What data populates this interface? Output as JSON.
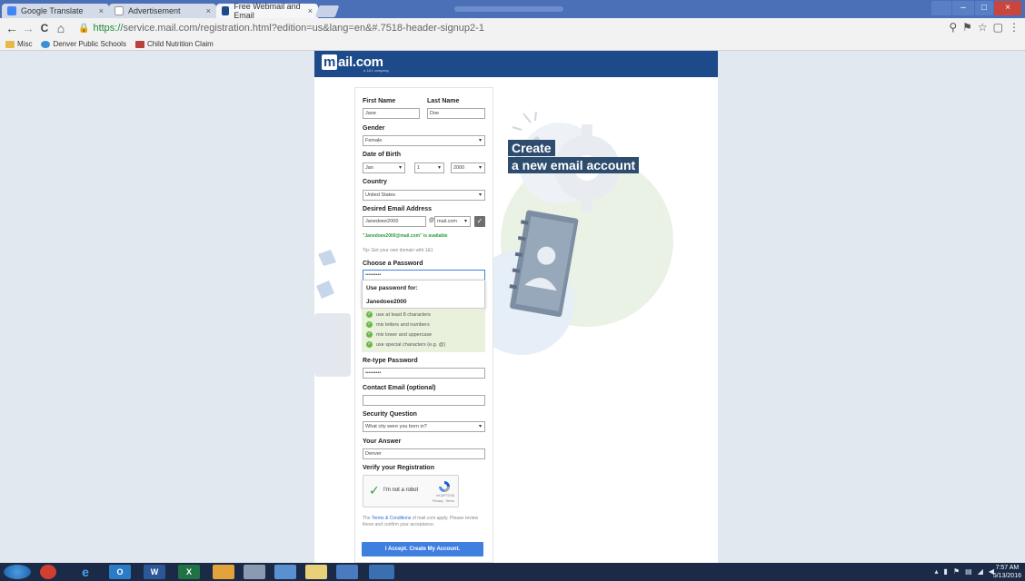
{
  "browser": {
    "tabs": [
      {
        "label": "Google Translate",
        "active": false
      },
      {
        "label": "Advertisement",
        "active": false
      },
      {
        "label": "Free Webmail and Email",
        "active": true
      }
    ],
    "tab_close": "×",
    "url_secure": "https://",
    "url_rest": "service.mail.com/registration.html?edition=us&lang=en&#.7518-header-signup2-1",
    "bookmarks": [
      "Misc",
      "Denver Public Schools",
      "Child Nutrition Claim"
    ],
    "nav": {
      "back": "←",
      "forward": "→",
      "reload": "C",
      "home": "⌂"
    }
  },
  "site": {
    "logo": "mail.com",
    "logo_m": "m",
    "logo_rest": "ail.com",
    "logo_sub": "a 1&1 company",
    "headline_line1": "Create",
    "headline_line2": "a new email account"
  },
  "form": {
    "first_name_label": "First Name",
    "last_name_label": "Last Name",
    "first_name_value": "Jane",
    "last_name_value": "Doe",
    "gender_label": "Gender",
    "gender_value": "Female",
    "dob_label": "Date of Birth",
    "dob_month": "Jan",
    "dob_day": "1",
    "dob_year": "2000",
    "country_label": "Country",
    "country_value": "United States",
    "email_label": "Desired Email Address",
    "email_value": "Janedoee2000",
    "at_sign": "@",
    "domain_value": "mail.com",
    "check": "✓",
    "available_text": "\"Janedoee2000@mail.com\" is available",
    "tip_text": "Tip: Get your own domain with 1&1",
    "password_label": "Choose a Password",
    "password_value": "•••••••••",
    "use_password_for": "Use password for:",
    "password_user": "Janedoee2000",
    "rules": [
      "use at least 8 characters",
      "mix letters and numbers",
      "mix lower and uppercase",
      "use special characters (e.g. @)"
    ],
    "retype_label": "Re-type Password",
    "retype_value": "•••••••••",
    "contact_label": "Contact Email (optional)",
    "contact_value": "",
    "security_label": "Security Question",
    "security_value": "What city were you born in?",
    "answer_label": "Your Answer",
    "answer_value": "Denver",
    "verify_label": "Verify your Registration",
    "captcha_text": "I'm not a robot",
    "captcha_brand": "reCAPTCHA",
    "captcha_links": "Privacy - Terms",
    "terms_pre": "The",
    "terms_link": "Terms & Conditions",
    "terms_post": "of mail.com apply. Please review these and confirm your acceptance.",
    "submit_label": "I Accept. Create My Account."
  },
  "taskbar": {
    "time": "7:57 AM",
    "date": "5/13/2016",
    "apps": [
      "outlook",
      "word",
      "excel"
    ],
    "outlook_label": "O",
    "word_label": "W",
    "excel_label": "X"
  },
  "colors": {
    "header_blue": "#1c4a8a",
    "button_blue": "#3f7fe0",
    "success_green": "#2e9b3c",
    "headline_bg": "#2d4c6e"
  }
}
